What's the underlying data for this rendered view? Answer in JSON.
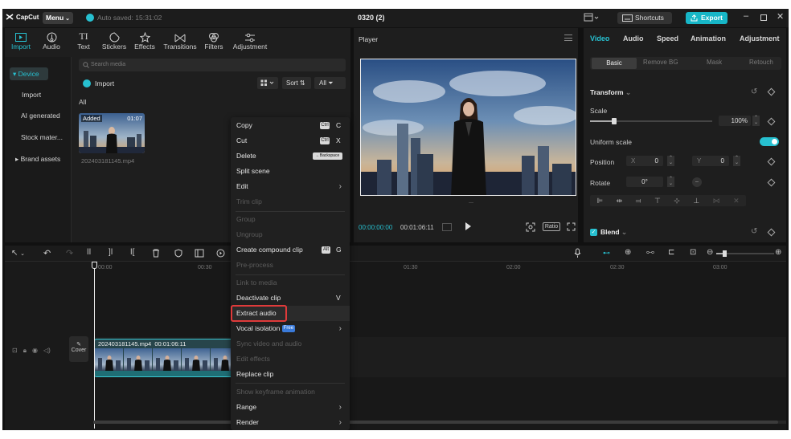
{
  "titlebar": {
    "logo": "CapCut",
    "menu_label": "Menu",
    "autosave": "Auto saved: 15:31:02",
    "project_title": "0320 (2)",
    "shortcuts_label": "Shortcuts",
    "export_label": "Export"
  },
  "toolbar": {
    "tools": [
      {
        "label": "Import",
        "icon": "import-icon"
      },
      {
        "label": "Audio",
        "icon": "audio-icon"
      },
      {
        "label": "Text",
        "icon": "text-icon"
      },
      {
        "label": "Stickers",
        "icon": "stickers-icon"
      },
      {
        "label": "Effects",
        "icon": "effects-icon"
      },
      {
        "label": "Transitions",
        "icon": "transitions-icon"
      },
      {
        "label": "Filters",
        "icon": "filters-icon"
      },
      {
        "label": "Adjustment",
        "icon": "adjustment-icon"
      }
    ]
  },
  "sidebar": {
    "items": [
      "Device",
      "Import",
      "AI generated",
      "Stock mater...",
      "Brand assets"
    ]
  },
  "media": {
    "search_placeholder": "Search media",
    "import_label": "Import",
    "sort_label": "Sort",
    "filter_all": "All",
    "section_all": "All",
    "clip_badge": "Added",
    "clip_duration": "01:07",
    "clip_filename": "202403181145.mp4"
  },
  "player": {
    "title": "Player",
    "time_current": "00:00:00:00",
    "time_total": "00:01:06:11",
    "ratio_label": "Ratio"
  },
  "inspector": {
    "tabs": [
      "Video",
      "Audio",
      "Speed",
      "Animation",
      "Adjustment"
    ],
    "subtabs": [
      "Basic",
      "Remove BG",
      "Mask",
      "Retouch"
    ],
    "transform_label": "Transform",
    "scale_label": "Scale",
    "scale_value": "100%",
    "scale_fraction": 0.2,
    "uniform_scale_label": "Uniform scale",
    "position_label": "Position",
    "pos_x_label": "X",
    "pos_x_value": "0",
    "pos_y_label": "Y",
    "pos_y_value": "0",
    "rotate_label": "Rotate",
    "rotate_value": "0°",
    "blend_label": "Blend"
  },
  "timeline": {
    "ticks": [
      "00:00",
      "00:30",
      "01:30",
      "02:00",
      "02:30",
      "03:00"
    ],
    "cover_label": "Cover",
    "clip_name": "202403181145.mp4",
    "clip_duration": "00:01:06:11"
  },
  "context_menu": {
    "items": [
      {
        "label": "Copy",
        "shortcut": "Ctrl",
        "key": "C",
        "enabled": true
      },
      {
        "label": "Cut",
        "shortcut": "Ctrl",
        "key": "X",
        "enabled": true
      },
      {
        "label": "Delete",
        "shortcut": "←Backspace",
        "key": "",
        "enabled": true
      },
      {
        "label": "Split scene",
        "enabled": true
      },
      {
        "label": "Edit",
        "enabled": true,
        "submenu": true
      },
      {
        "label": "Trim clip",
        "enabled": false
      },
      {
        "label": "Group",
        "enabled": false
      },
      {
        "label": "Ungroup",
        "enabled": false
      },
      {
        "label": "Create compound clip",
        "shortcut": "Alt",
        "key": "G",
        "enabled": true
      },
      {
        "label": "Pre-process",
        "enabled": false
      },
      {
        "label": "Link to media",
        "enabled": false
      },
      {
        "label": "Deactivate clip",
        "key": "V",
        "enabled": true
      },
      {
        "label": "Extract audio",
        "enabled": true,
        "highlighted": true
      },
      {
        "label": "Vocal isolation",
        "badge": "Free",
        "enabled": true,
        "submenu": true
      },
      {
        "label": "Sync video and audio",
        "enabled": false
      },
      {
        "label": "Edit effects",
        "enabled": false
      },
      {
        "label": "Replace clip",
        "enabled": true
      },
      {
        "label": "Show keyframe animation",
        "enabled": false
      },
      {
        "label": "Range",
        "enabled": true,
        "submenu": true
      },
      {
        "label": "Render",
        "enabled": true,
        "submenu": true
      }
    ]
  },
  "colors": {
    "accent": "#27c0d0",
    "highlight_border": "#e03a3a",
    "panel_bg": "#1e1e1e",
    "app_bg": "#111111"
  }
}
